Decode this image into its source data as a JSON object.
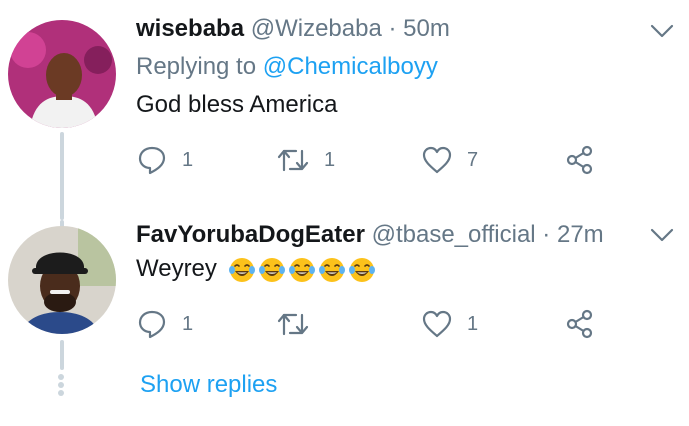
{
  "tweets": [
    {
      "name": "wisebaba",
      "handle": "@Wizebaba",
      "separator": "·",
      "time": "50m",
      "replying_prefix": "Replying to",
      "replying_mention": "@Chemicalboyy",
      "text": "God bless America",
      "reply_count": "1",
      "retweet_count": "1",
      "like_count": "7",
      "avatar_colors": {
        "bg": "#b0307a",
        "skin": "#6b3a24",
        "shirt": "#f2f2f2"
      }
    },
    {
      "name": "FavYorubaDogEater",
      "handle": "@tbase_official",
      "separator": "·",
      "time": "27m",
      "text": "Weyrey",
      "emoji": "laughing-crying-face",
      "emoji_count": 5,
      "reply_count": "1",
      "retweet_count": "",
      "like_count": "1",
      "avatar_colors": {
        "bg": "#d8d4cc",
        "skin": "#4a2c1c",
        "shirt": "#2b4a8a"
      }
    }
  ],
  "show_replies": "Show replies",
  "colors": {
    "accent": "#1da1f2",
    "muted": "#657786",
    "text": "#14171a",
    "line": "#ccd6dd"
  },
  "icons": [
    "reply-icon",
    "retweet-icon",
    "like-icon",
    "share-icon",
    "chevron-down-icon"
  ]
}
